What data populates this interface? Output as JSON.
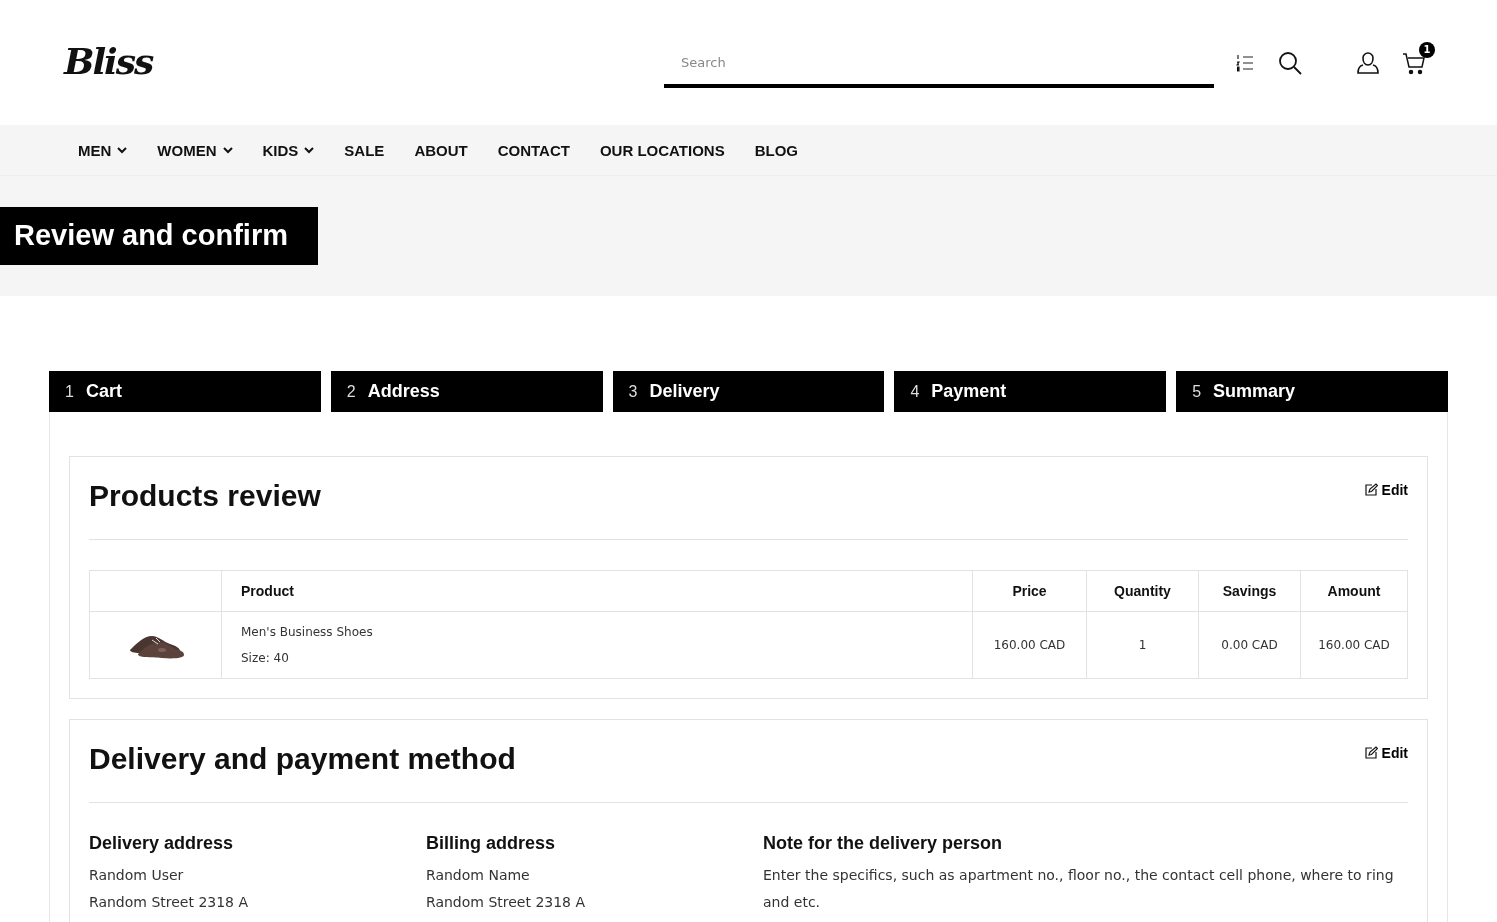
{
  "header": {
    "logo": "Bliss",
    "search": {
      "placeholder": "Search"
    },
    "cart_count": "1"
  },
  "nav": [
    {
      "label": "MEN",
      "dropdown": true
    },
    {
      "label": "WOMEN",
      "dropdown": true
    },
    {
      "label": "KIDS",
      "dropdown": true
    },
    {
      "label": "SALE",
      "dropdown": false
    },
    {
      "label": "ABOUT",
      "dropdown": false
    },
    {
      "label": "CONTACT",
      "dropdown": false
    },
    {
      "label": "OUR LOCATIONS",
      "dropdown": false
    },
    {
      "label": "BLOG",
      "dropdown": false
    }
  ],
  "page_title": "Review and confirm",
  "steps": [
    {
      "number": "1",
      "label": "Cart"
    },
    {
      "number": "2",
      "label": "Address"
    },
    {
      "number": "3",
      "label": "Delivery"
    },
    {
      "number": "4",
      "label": "Payment"
    },
    {
      "number": "5",
      "label": "Summary"
    }
  ],
  "products_review": {
    "title": "Products review",
    "edit": "Edit",
    "columns": [
      "Product",
      "Price",
      "Quantity",
      "Savings",
      "Amount"
    ],
    "rows": [
      {
        "name": "Men's Business Shoes",
        "size": "Size: 40",
        "price": "160.00 CAD",
        "quantity": "1",
        "savings": "0.00 CAD",
        "amount": "160.00 CAD"
      }
    ]
  },
  "delivery_payment": {
    "title": "Delivery and payment method",
    "edit": "Edit",
    "blocks": [
      {
        "title": "Delivery address",
        "lines": [
          "Random User",
          "Random Street 2318 A"
        ]
      },
      {
        "title": "Billing address",
        "lines": [
          "Random Name",
          "Random Street 2318 A"
        ]
      },
      {
        "title": "Note for the delivery person",
        "lines": [
          "Enter the specifics, such as apartment no., floor no., the contact cell phone, where to ring and etc."
        ]
      }
    ]
  }
}
